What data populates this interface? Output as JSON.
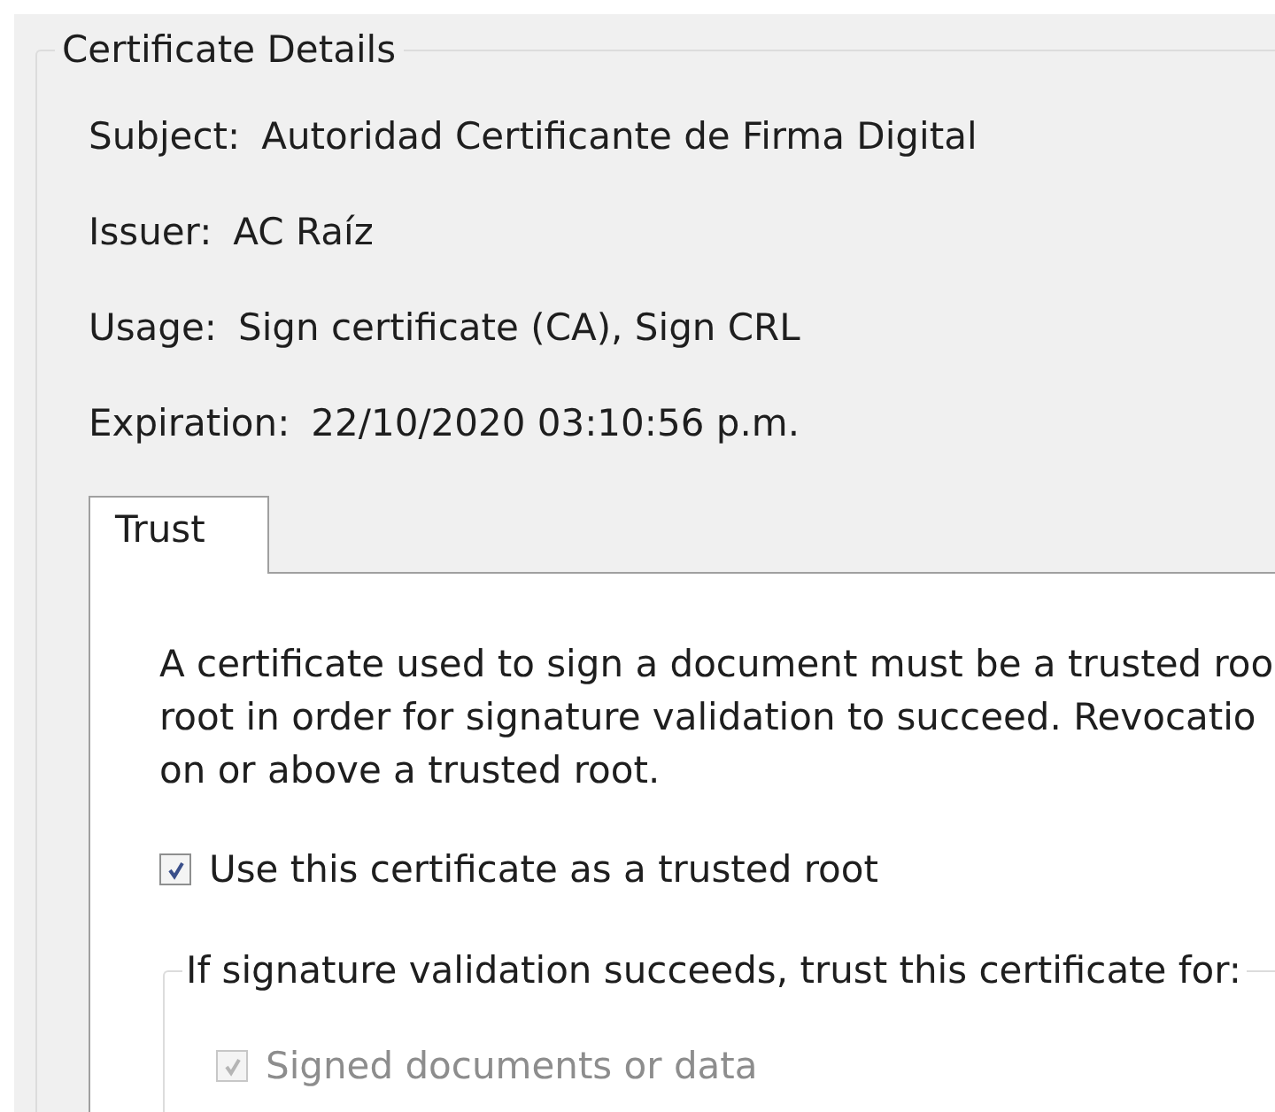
{
  "group": {
    "title": "Certificate Details"
  },
  "details": [
    {
      "label": "Subject:",
      "value": "Autoridad Certificante de Firma Digital"
    },
    {
      "label": "Issuer:",
      "value": "AC Raíz"
    },
    {
      "label": "Usage:",
      "value": "Sign certificate (CA), Sign CRL"
    },
    {
      "label": "Expiration:",
      "value": "22/10/2020 03:10:56 p.m."
    }
  ],
  "tabs": [
    {
      "label": "Trust",
      "selected": true
    }
  ],
  "description": [
    "A certificate used to sign a document must be a trusted roo",
    "root in order for signature validation to succeed.  Revocatio",
    "on or above a trusted root."
  ],
  "trusted_root": {
    "label": "Use this certificate as a trusted root",
    "checked": true,
    "disabled": false
  },
  "trust_group": {
    "title": "If signature validation succeeds, trust this certificate for:",
    "options": [
      {
        "label": "Signed documents or data",
        "checked": true,
        "disabled": true
      }
    ]
  }
}
